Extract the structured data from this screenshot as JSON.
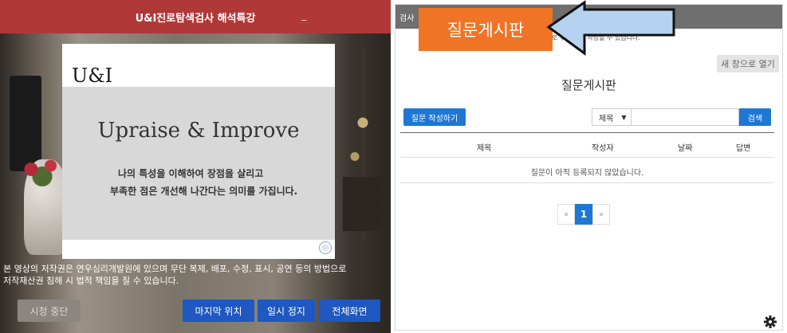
{
  "player": {
    "title": "U&I진로탐색검사 해석특강",
    "minimize": "_",
    "slide": {
      "logo": "U&I",
      "heading": "Upraise & Improve",
      "line1": "나의 특성을 이해하여 장점을 살리고",
      "line2": "부족한 점은 개선해 나간다는 의미를 가집니다."
    },
    "copyright_line1": "본 영상의 저작권은 연우심리개발원에 있으며 무단 복제, 배포, 수정, 표시, 공연 등의 방법으로",
    "copyright_line2": "저작재산권 침해 시 법적 책임을 질 수 있습니다.",
    "buttons": {
      "stop": "시청 중단",
      "last_position": "마지막 위치",
      "pause": "일시 정지",
      "fullscreen": "전체화면"
    }
  },
  "board": {
    "topbar_label": "검사",
    "notice": "로 후에 질문 작성할 수 있습니다.",
    "new_window": "새 창으로 열기",
    "title": "질문게시판",
    "write_button": "질문 작성하기",
    "search": {
      "select_value": "제목",
      "caret": "▼",
      "input_value": "",
      "button": "검색"
    },
    "columns": [
      "제목",
      "작성자",
      "날짜",
      "답변"
    ],
    "empty_message": "질문이 아직 등록되지 않았습니다.",
    "pagination": {
      "prev": "«",
      "current": "1",
      "next": "»"
    },
    "settings_icon": "gear-icon"
  },
  "overlay": {
    "label": "질문게시판"
  },
  "colors": {
    "player_bar": "#b03838",
    "player_button": "#1e58c0",
    "board_accent": "#1e77d3",
    "overlay_orange": "#f07426",
    "arrow_fill": "#b5d3f0"
  }
}
